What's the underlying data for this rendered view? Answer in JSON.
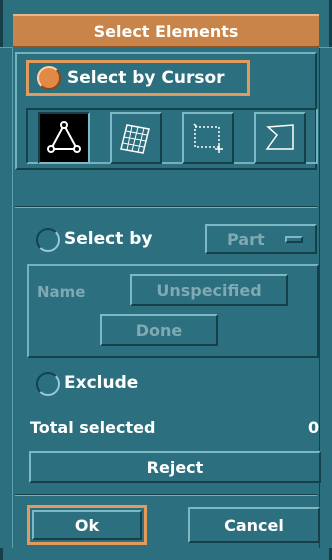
{
  "window": {
    "title": "Select Elements"
  },
  "cursor_section": {
    "radio_label": "Select by Cursor",
    "radio_selected": true,
    "tools": [
      {
        "name": "node-triangle-icon",
        "active": true
      },
      {
        "name": "mesh-surface-icon",
        "active": false
      },
      {
        "name": "box-select-icon",
        "active": false
      },
      {
        "name": "polygon-select-icon",
        "active": false
      }
    ]
  },
  "select_by_section": {
    "radio_label": "Select by",
    "radio_selected": false,
    "dropdown_value": "Part",
    "name_label": "Name",
    "name_value": "Unspecified",
    "done_label": "Done"
  },
  "exclude": {
    "radio_label": "Exclude",
    "radio_selected": false
  },
  "total": {
    "label": "Total selected",
    "value": "0"
  },
  "reject_label": "Reject",
  "footer": {
    "ok_label": "Ok",
    "cancel_label": "Cancel"
  }
}
